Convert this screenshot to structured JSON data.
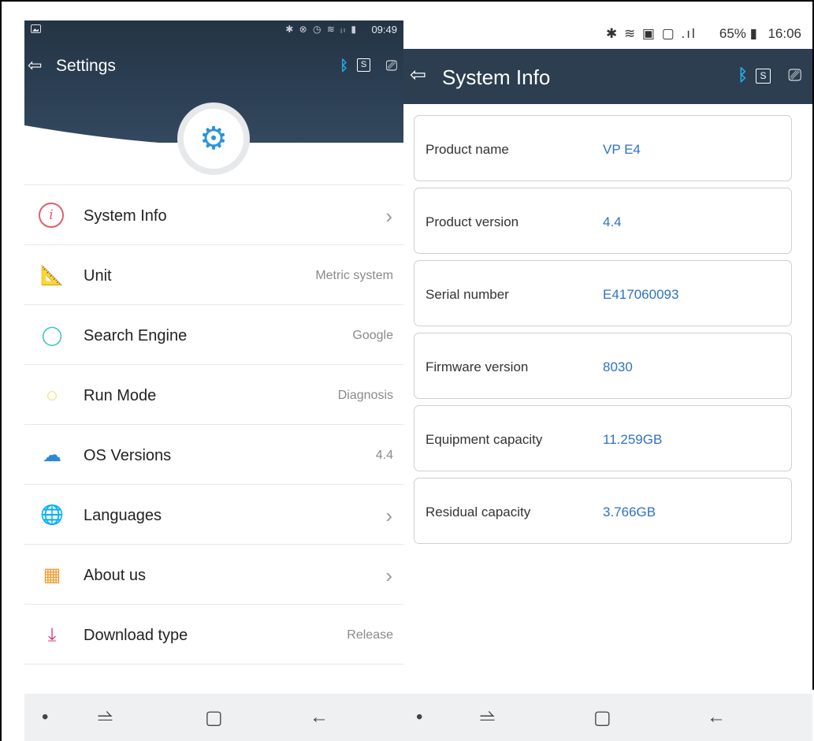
{
  "left": {
    "status": {
      "icons": "✱ ⊗ ◷ ≋ ᵢₗ ▮ ",
      "time": "09:49"
    },
    "title": "Settings",
    "items": [
      {
        "label": "System Info",
        "value": "",
        "chevron": "›",
        "icon": "info-circle"
      },
      {
        "label": "Unit",
        "value": "Metric system",
        "chevron": "",
        "icon": "ruler"
      },
      {
        "label": "Search Engine",
        "value": "Google",
        "chevron": "",
        "icon": "search"
      },
      {
        "label": "Run Mode",
        "value": "Diagnosis",
        "chevron": "",
        "icon": "run-circle"
      },
      {
        "label": "OS Versions",
        "value": "4.4",
        "chevron": "",
        "icon": "cloud-upload"
      },
      {
        "label": "Languages",
        "value": "",
        "chevron": "›",
        "icon": "globe"
      },
      {
        "label": "About us",
        "value": "",
        "chevron": "›",
        "icon": "building"
      },
      {
        "label": "Download type",
        "value": "Release",
        "chevron": "",
        "icon": "download"
      }
    ]
  },
  "right": {
    "status": {
      "icons": "✱ ≋ ▣ ▢ .ıl",
      "battery": "65% ▮",
      "time": "16:06"
    },
    "title": "System Info",
    "info": [
      {
        "label": "Product name",
        "value": "VP E4"
      },
      {
        "label": "Product version",
        "value": "4.4"
      },
      {
        "label": "Serial number",
        "value": "E417060093"
      },
      {
        "label": "Firmware version",
        "value": "8030"
      },
      {
        "label": "Equipment capacity",
        "value": "11.259GB"
      },
      {
        "label": "Residual capacity",
        "value": "3.766GB"
      }
    ]
  },
  "nav": {
    "dot": "•",
    "recent": "⥬",
    "home": "▢",
    "back": "←"
  },
  "colors": {
    "header_bg": "#2c3e50",
    "accent_blue": "#2f72c4",
    "bluetooth": "#27a9e0"
  }
}
